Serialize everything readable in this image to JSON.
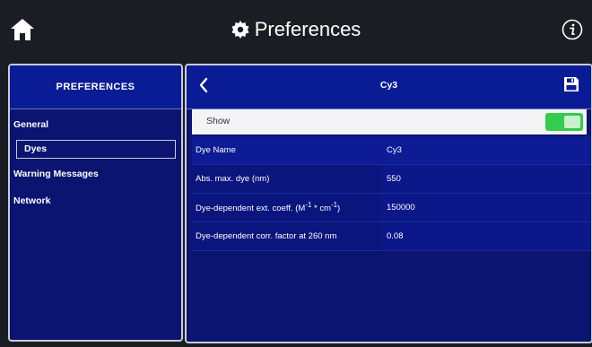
{
  "window": {
    "title": "Preferences"
  },
  "topbar": {
    "home_icon": "home-icon",
    "gear_icon": "gear-icon",
    "info_icon": "info-icon"
  },
  "sidebar": {
    "header": "PREFERENCES",
    "items": [
      {
        "label": "General",
        "selected": false
      },
      {
        "label": "Dyes",
        "selected": true
      },
      {
        "label": "Warning Messages",
        "selected": false
      },
      {
        "label": "Network",
        "selected": false
      }
    ]
  },
  "detail": {
    "title": "Cy3",
    "back_icon": "chevron-left-icon",
    "save_icon": "save-icon",
    "show": {
      "label": "Show",
      "enabled": true
    },
    "properties": [
      {
        "name": "Dye Name",
        "value": "Cy3"
      },
      {
        "name": "Abs. max. dye (nm)",
        "value": "550"
      },
      {
        "name_prefix": "Dye-dependent ext. coeff. (M",
        "sup1": "-1",
        "name_mid": " * cm",
        "sup2": "-1",
        "name_suffix": ")",
        "value": "150000"
      },
      {
        "name": "Dye-dependent corr. factor at 260 nm",
        "value": "0.08"
      }
    ]
  },
  "colors": {
    "panel_bg": "#0b1470",
    "header_bg": "#0a1c95",
    "toggle_on": "#33cc4e",
    "top_bg": "#1b1d24"
  }
}
